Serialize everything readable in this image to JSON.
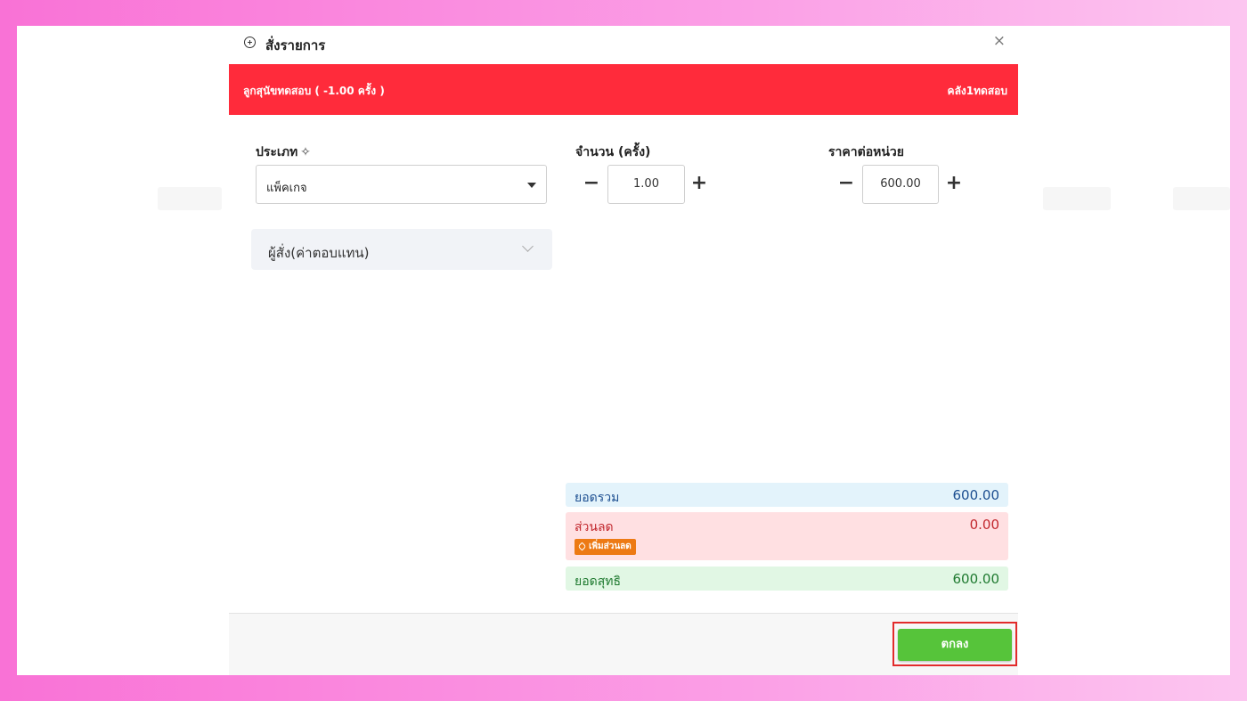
{
  "modal": {
    "title": "สั่งรายการ",
    "close_symbol": "×"
  },
  "banner": {
    "left_text": "ลูกสุนัขทดสอบ ( -1.00 ครั้ง )",
    "right_text": "คลัง1ทดสอบ",
    "color": "#ff2b3b"
  },
  "type_field": {
    "label": "ประเภท",
    "label_icon": "sparkle-icon",
    "selected": "แพ็คเกจ"
  },
  "quantity_field": {
    "label": "จำนวน (ครั้ง)",
    "value": "1.00",
    "minus": "−",
    "plus": "+"
  },
  "unit_price_field": {
    "label": "ราคาต่อหน่วย",
    "value": "600.00",
    "minus": "−",
    "plus": "+"
  },
  "orderer": {
    "label": "ผู้สั่ง(ค่าตอบแทน)"
  },
  "summary": {
    "total_label": "ยอดรวม",
    "total_value": "600.00",
    "discount_label": "ส่วนลด",
    "discount_value": "0.00",
    "add_discount_label": "เพิ่มส่วนลด",
    "net_label": "ยอดสุทธิ",
    "net_value": "600.00"
  },
  "footer": {
    "ok_label": "ตกลง",
    "ok_color": "#56c43a"
  }
}
